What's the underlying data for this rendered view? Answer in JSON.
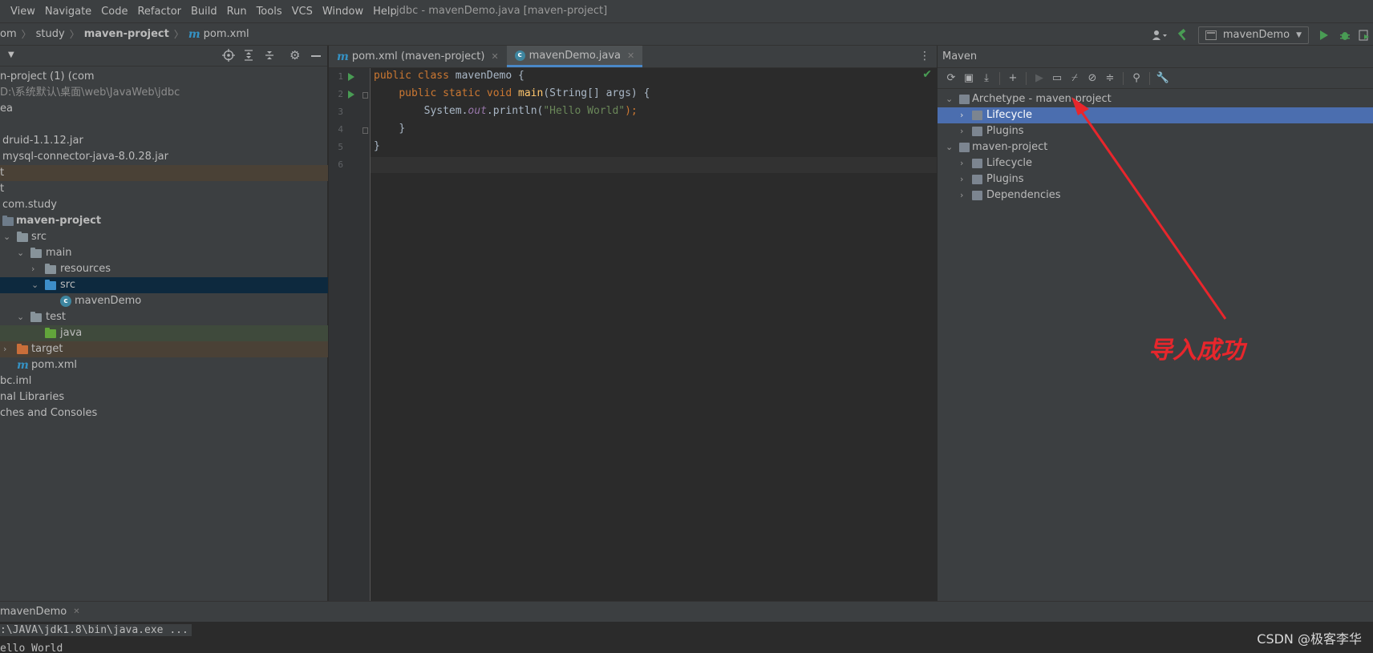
{
  "menu": [
    "View",
    "Navigate",
    "Code",
    "Refactor",
    "Build",
    "Run",
    "Tools",
    "VCS",
    "Window",
    "Help"
  ],
  "window_title": "jdbc - mavenDemo.java [maven-project]",
  "breadcrumbs": [
    "om",
    "study",
    "maven-project",
    "pom.xml"
  ],
  "run_config": "mavenDemo",
  "project_tree": [
    "n-project (1) (com",
    "D:\\系统默认\\桌面\\web\\JavaWeb\\jdbc",
    "ea",
    "druid-1.1.12.jar",
    "mysql-connector-java-8.0.28.jar",
    "t",
    "t",
    "com.study",
    "maven-project",
    "src",
    "main",
    "resources",
    "src",
    "mavenDemo",
    "test",
    "java",
    "target",
    "pom.xml",
    "bc.iml",
    "nal Libraries",
    "ches and Consoles"
  ],
  "editor_tabs": [
    {
      "label": "pom.xml (maven-project)"
    },
    {
      "label": "mavenDemo.java"
    }
  ],
  "code": {
    "line_numbers": [
      "1",
      "2",
      "3",
      "4",
      "5",
      "6"
    ],
    "l1_kw": "public class",
    "l1_name": " mavenDemo {",
    "l2_kw": "public static void",
    "l2_fn": "main",
    "l2_rest": "(String[] args) {",
    "l3_a": "System.",
    "l3_out": "out",
    "l3_b": ".println(",
    "l3_str": "\"Hello World\"",
    "l3_c": ");",
    "l4": "}",
    "l5": "}"
  },
  "maven": {
    "title": "Maven",
    "tree": [
      "Archetype - maven-project",
      "Lifecycle",
      "Plugins",
      "maven-project",
      "Lifecycle",
      "Plugins",
      "Dependencies"
    ]
  },
  "annotation": "导入成功",
  "run_tab": "mavenDemo",
  "console": [
    ":\\JAVA\\jdk1.8\\bin\\java.exe ...",
    "ello World"
  ],
  "watermark": "CSDN @极客李华",
  "colors": {
    "accent": "#4b6eaf",
    "annotation": "#e8262c",
    "keyword": "#cc7832",
    "string": "#6a8759"
  }
}
